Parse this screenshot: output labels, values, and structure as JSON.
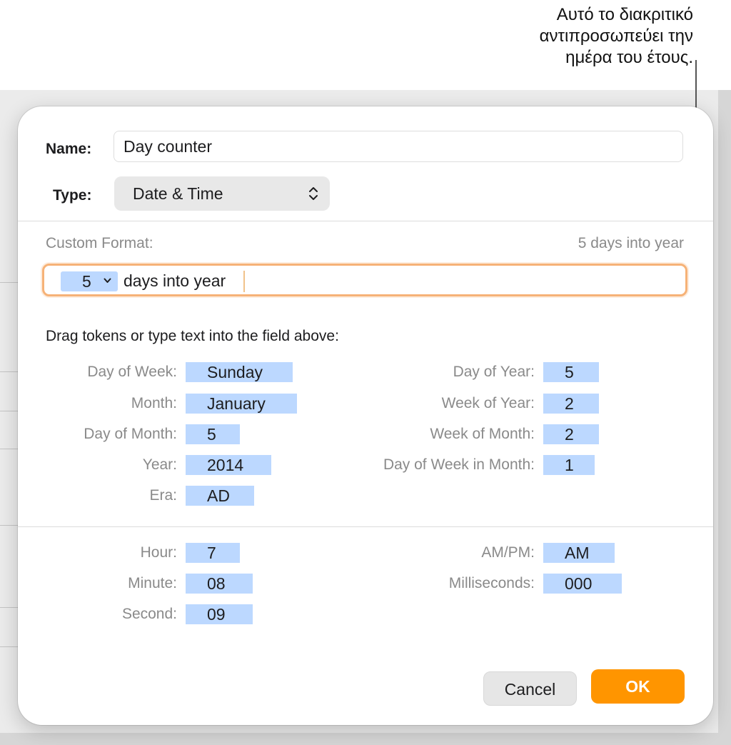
{
  "callout": {
    "text": "Αυτό το διακριτικό\nαντιπροσωπεύει την\nημέρα του έτους."
  },
  "dialog": {
    "name_label": "Name:",
    "name_value": "Day counter",
    "type_label": "Type:",
    "type_value": "Date & Time",
    "custom_format_label": "Custom Format:",
    "preview": "5 days into year",
    "format_field": {
      "token": "5",
      "text": "days into year"
    },
    "instructions": "Drag tokens or type text into the field above:",
    "date_tokens_left": [
      {
        "label": "Day of Week:",
        "value": "Sunday"
      },
      {
        "label": "Month:",
        "value": "January"
      },
      {
        "label": "Day of Month:",
        "value": "5"
      },
      {
        "label": "Year:",
        "value": "2014"
      },
      {
        "label": "Era:",
        "value": "AD"
      }
    ],
    "date_tokens_right": [
      {
        "label": "Day of Year:",
        "value": "5"
      },
      {
        "label": "Week of Year:",
        "value": "2"
      },
      {
        "label": "Week of Month:",
        "value": "2"
      },
      {
        "label": "Day of Week in Month:",
        "value": "1"
      }
    ],
    "time_tokens_left": [
      {
        "label": "Hour:",
        "value": "7"
      },
      {
        "label": "Minute:",
        "value": "08"
      },
      {
        "label": "Second:",
        "value": "09"
      }
    ],
    "time_tokens_right": [
      {
        "label": "AM/PM:",
        "value": "AM"
      },
      {
        "label": "Milliseconds:",
        "value": "000"
      }
    ],
    "cancel_label": "Cancel",
    "ok_label": "OK"
  },
  "colors": {
    "accent": "#ff9500",
    "token": "#bcd8ff",
    "focus_ring": "#f6b277"
  }
}
